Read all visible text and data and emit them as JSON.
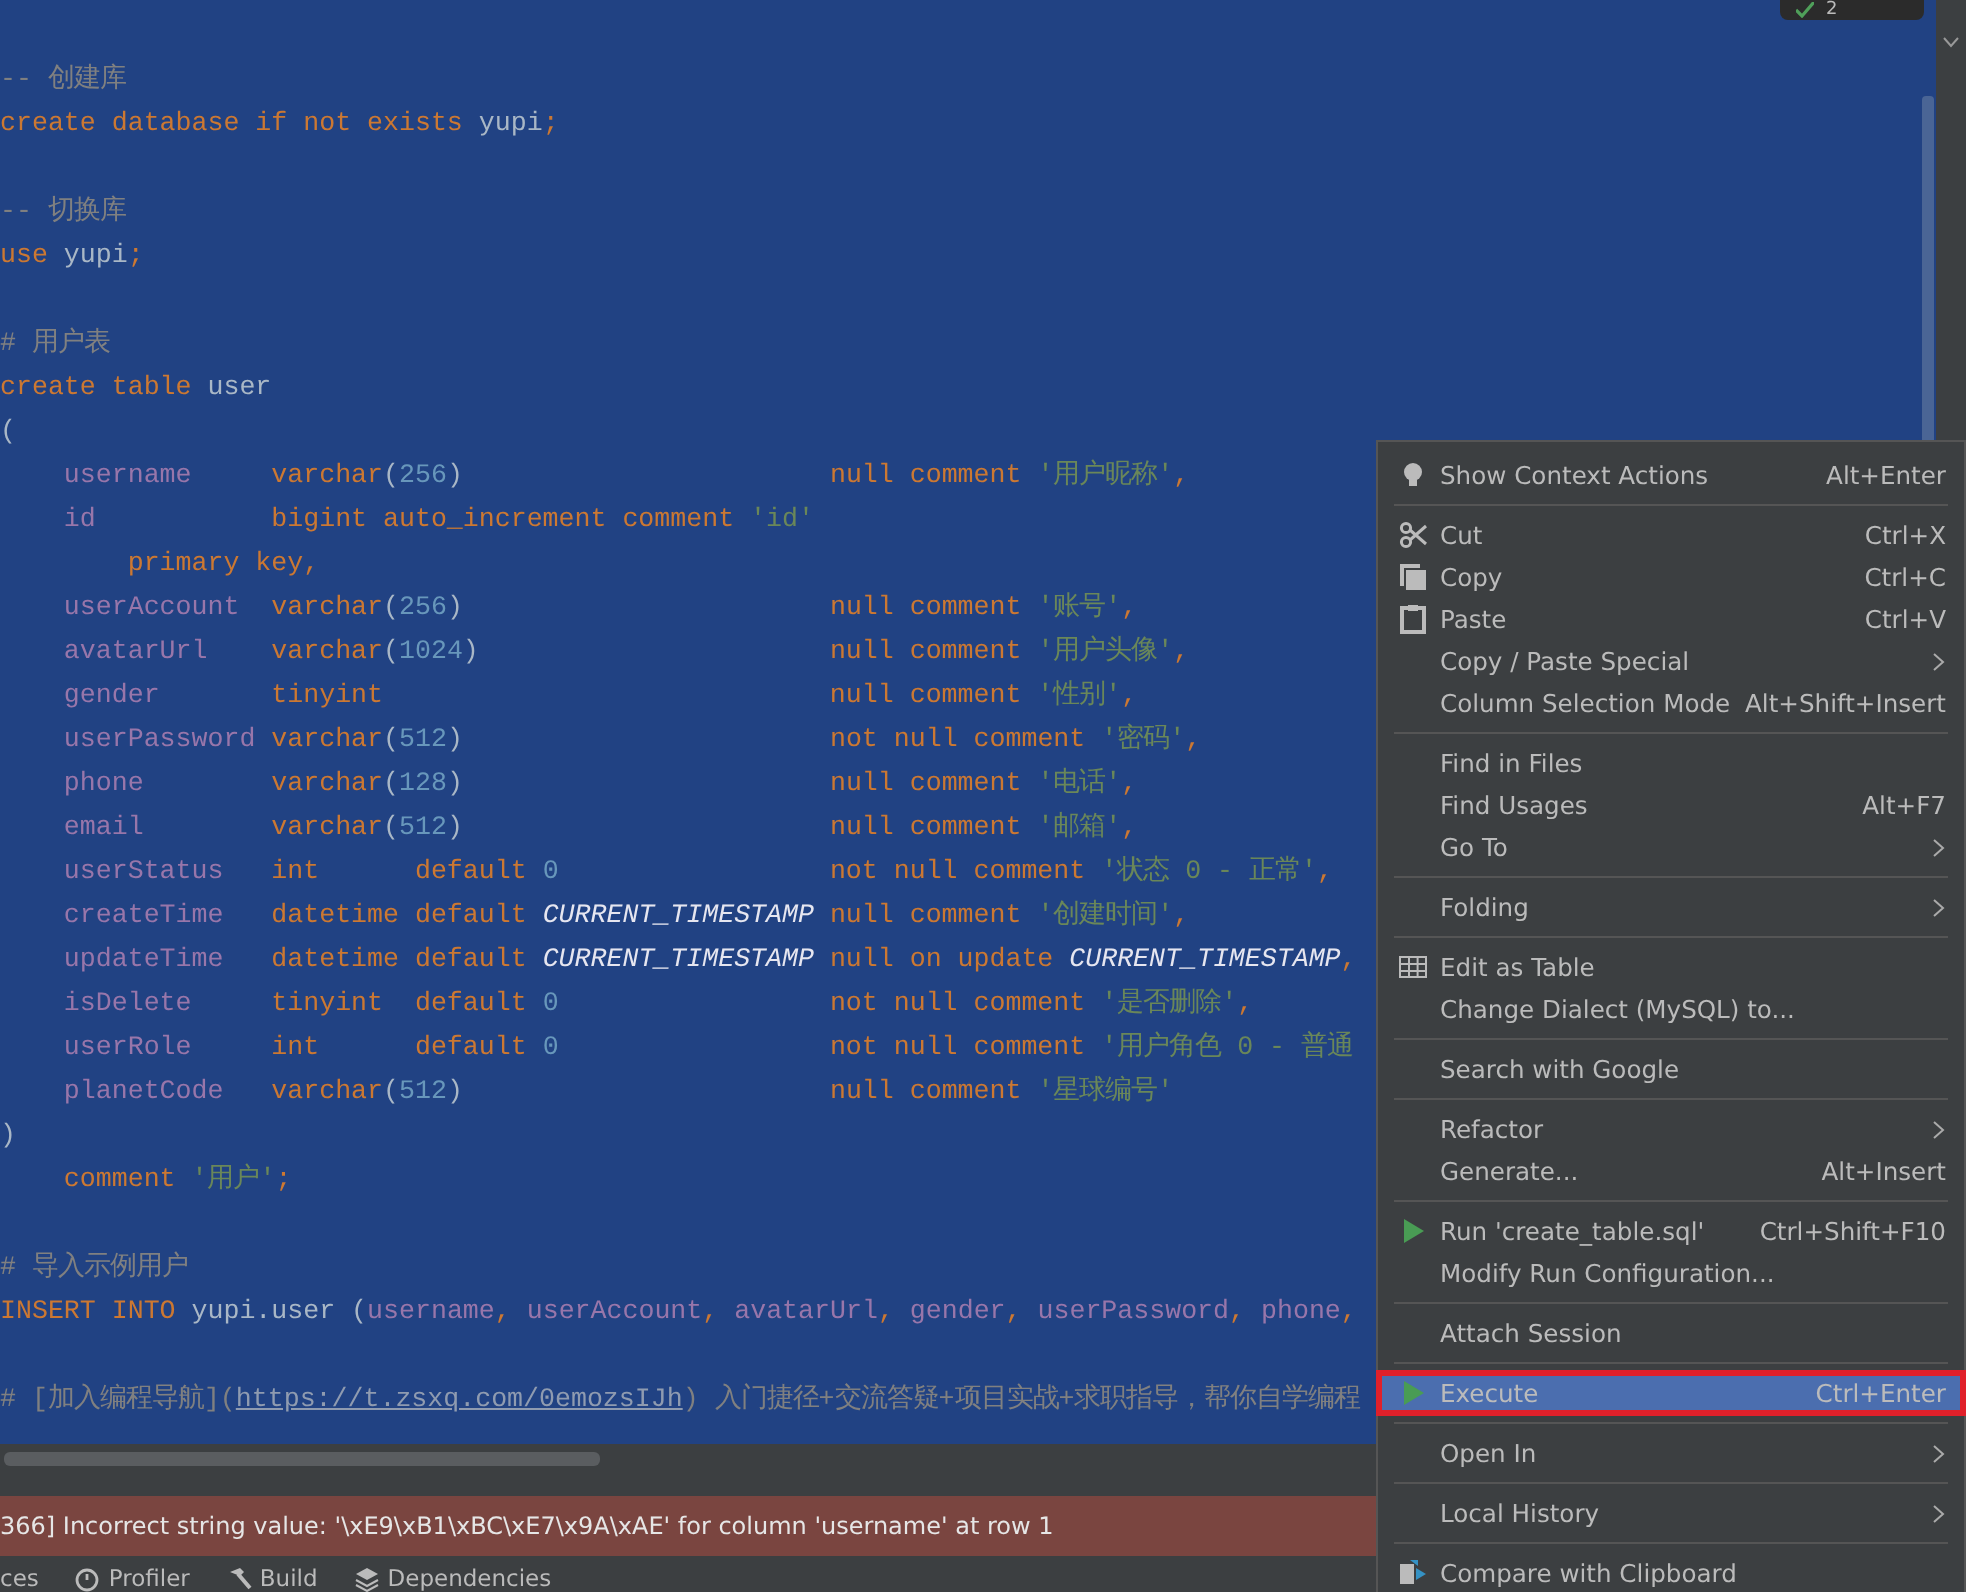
{
  "editor": {
    "inspection_count": "2",
    "blocks": [
      [
        [
          {
            "kind": "cmt",
            "text": "-- 创建库"
          }
        ],
        [
          {
            "kind": "kw",
            "text": "create database if not exists "
          },
          {
            "kind": "plain",
            "text": "yupi"
          },
          {
            "kind": "kw",
            "text": ";"
          }
        ]
      ],
      [
        [
          {
            "kind": "cmt",
            "text": "-- 切换库"
          }
        ],
        [
          {
            "kind": "kw",
            "text": "use "
          },
          {
            "kind": "plain",
            "text": "yupi"
          },
          {
            "kind": "kw",
            "text": ";"
          }
        ]
      ],
      [
        [
          {
            "kind": "cmt",
            "text": "# 用户表"
          }
        ],
        [
          {
            "kind": "kw",
            "text": "create table "
          },
          {
            "kind": "plain",
            "text": "user"
          }
        ],
        [
          {
            "kind": "plain",
            "text": "("
          }
        ],
        [
          {
            "kind": "col",
            "text": "    username     "
          },
          {
            "kind": "kw",
            "text": "varchar"
          },
          {
            "kind": "plain",
            "text": "("
          },
          {
            "kind": "num",
            "text": "256"
          },
          {
            "kind": "plain",
            "text": ")                       "
          },
          {
            "kind": "kw",
            "text": "null comment "
          },
          {
            "kind": "str",
            "text": "'用户昵称'"
          },
          {
            "kind": "kw",
            "text": ","
          }
        ],
        [
          {
            "kind": "col",
            "text": "    id           "
          },
          {
            "kind": "kw",
            "text": "bigint auto_increment comment "
          },
          {
            "kind": "str",
            "text": "'id'"
          }
        ],
        [
          {
            "kind": "kw",
            "text": "        primary key,"
          }
        ],
        [
          {
            "kind": "col",
            "text": "    userAccount  "
          },
          {
            "kind": "kw",
            "text": "varchar"
          },
          {
            "kind": "plain",
            "text": "("
          },
          {
            "kind": "num",
            "text": "256"
          },
          {
            "kind": "plain",
            "text": ")                       "
          },
          {
            "kind": "kw",
            "text": "null comment "
          },
          {
            "kind": "str",
            "text": "'账号'"
          },
          {
            "kind": "kw",
            "text": ","
          }
        ],
        [
          {
            "kind": "col",
            "text": "    avatarUrl    "
          },
          {
            "kind": "kw",
            "text": "varchar"
          },
          {
            "kind": "plain",
            "text": "("
          },
          {
            "kind": "num",
            "text": "1024"
          },
          {
            "kind": "plain",
            "text": ")                      "
          },
          {
            "kind": "kw",
            "text": "null comment "
          },
          {
            "kind": "str",
            "text": "'用户头像'"
          },
          {
            "kind": "kw",
            "text": ","
          }
        ],
        [
          {
            "kind": "col",
            "text": "    gender       "
          },
          {
            "kind": "kw",
            "text": "tinyint                            null comment "
          },
          {
            "kind": "str",
            "text": "'性别'"
          },
          {
            "kind": "kw",
            "text": ","
          }
        ],
        [
          {
            "kind": "col",
            "text": "    userPassword "
          },
          {
            "kind": "kw",
            "text": "varchar"
          },
          {
            "kind": "plain",
            "text": "("
          },
          {
            "kind": "num",
            "text": "512"
          },
          {
            "kind": "plain",
            "text": ")                       "
          },
          {
            "kind": "kw",
            "text": "not null comment "
          },
          {
            "kind": "str",
            "text": "'密码'"
          },
          {
            "kind": "kw",
            "text": ","
          }
        ],
        [
          {
            "kind": "col",
            "text": "    phone        "
          },
          {
            "kind": "kw",
            "text": "varchar"
          },
          {
            "kind": "plain",
            "text": "("
          },
          {
            "kind": "num",
            "text": "128"
          },
          {
            "kind": "plain",
            "text": ")                       "
          },
          {
            "kind": "kw",
            "text": "null comment "
          },
          {
            "kind": "str",
            "text": "'电话'"
          },
          {
            "kind": "kw",
            "text": ","
          }
        ],
        [
          {
            "kind": "col",
            "text": "    email        "
          },
          {
            "kind": "kw",
            "text": "varchar"
          },
          {
            "kind": "plain",
            "text": "("
          },
          {
            "kind": "num",
            "text": "512"
          },
          {
            "kind": "plain",
            "text": ")                       "
          },
          {
            "kind": "kw",
            "text": "null comment "
          },
          {
            "kind": "str",
            "text": "'邮箱'"
          },
          {
            "kind": "kw",
            "text": ","
          }
        ],
        [
          {
            "kind": "col",
            "text": "    userStatus   "
          },
          {
            "kind": "kw",
            "text": "int      default "
          },
          {
            "kind": "num",
            "text": "0                 "
          },
          {
            "kind": "kw",
            "text": "not null comment "
          },
          {
            "kind": "str",
            "text": "'状态 0 - 正常'"
          },
          {
            "kind": "kw",
            "text": ","
          }
        ],
        [
          {
            "kind": "col",
            "text": "    createTime   "
          },
          {
            "kind": "kw",
            "text": "datetime default "
          },
          {
            "kind": "fn",
            "text": "CURRENT_TIMESTAMP"
          },
          {
            "kind": "kw",
            "text": " null comment "
          },
          {
            "kind": "str",
            "text": "'创建时间'"
          },
          {
            "kind": "kw",
            "text": ","
          }
        ],
        [
          {
            "kind": "col",
            "text": "    updateTime   "
          },
          {
            "kind": "kw",
            "text": "datetime default "
          },
          {
            "kind": "fn",
            "text": "CURRENT_TIMESTAMP"
          },
          {
            "kind": "kw",
            "text": " null on update "
          },
          {
            "kind": "fn",
            "text": "CURRENT_TIMESTAMP"
          },
          {
            "kind": "kw",
            "text": ","
          }
        ],
        [
          {
            "kind": "col",
            "text": "    isDelete     "
          },
          {
            "kind": "kw",
            "text": "tinyint  default "
          },
          {
            "kind": "num",
            "text": "0                 "
          },
          {
            "kind": "kw",
            "text": "not null comment "
          },
          {
            "kind": "str",
            "text": "'是否删除'"
          },
          {
            "kind": "kw",
            "text": ","
          }
        ],
        [
          {
            "kind": "col",
            "text": "    userRole     "
          },
          {
            "kind": "kw",
            "text": "int      default "
          },
          {
            "kind": "num",
            "text": "0                 "
          },
          {
            "kind": "kw",
            "text": "not null comment "
          },
          {
            "kind": "str",
            "text": "'用户角色 0 - 普通"
          }
        ],
        [
          {
            "kind": "col",
            "text": "    planetCode   "
          },
          {
            "kind": "kw",
            "text": "varchar"
          },
          {
            "kind": "plain",
            "text": "("
          },
          {
            "kind": "num",
            "text": "512"
          },
          {
            "kind": "plain",
            "text": ")                       "
          },
          {
            "kind": "kw",
            "text": "null comment "
          },
          {
            "kind": "str",
            "text": "'星球编号'"
          }
        ],
        [
          {
            "kind": "plain",
            "text": ")"
          }
        ],
        [
          {
            "kind": "kw",
            "text": "    comment "
          },
          {
            "kind": "str",
            "text": "'用户'"
          },
          {
            "kind": "kw",
            "text": ";"
          }
        ]
      ],
      [
        [
          {
            "kind": "cmt",
            "text": "# 导入示例用户"
          }
        ],
        [
          {
            "kind": "kw",
            "text": "INSERT INTO "
          },
          {
            "kind": "plain",
            "text": "yupi.user ("
          },
          {
            "kind": "col",
            "text": "username"
          },
          {
            "kind": "kw",
            "text": ", "
          },
          {
            "kind": "col",
            "text": "userAccount"
          },
          {
            "kind": "kw",
            "text": ", "
          },
          {
            "kind": "col",
            "text": "avatarUrl"
          },
          {
            "kind": "kw",
            "text": ", "
          },
          {
            "kind": "col",
            "text": "gender"
          },
          {
            "kind": "kw",
            "text": ", "
          },
          {
            "kind": "col",
            "text": "userPassword"
          },
          {
            "kind": "kw",
            "text": ", "
          },
          {
            "kind": "col",
            "text": "phone"
          },
          {
            "kind": "kw",
            "text": ","
          }
        ]
      ],
      [
        [
          {
            "kind": "cmt",
            "text": "# [加入编程导航]("
          },
          {
            "kind": "link",
            "text": "https://t.zsxq.com/0emozsIJh"
          },
          {
            "kind": "cmt",
            "text": ") 入门捷径+交流答疑+项目实战+求职指导，帮你自学编程"
          }
        ]
      ]
    ]
  },
  "context_menu": {
    "groups": [
      [
        {
          "label": "Show Context Actions",
          "shortcut": "Alt+Enter",
          "kind": "bulb",
          "submenu": false,
          "selected": false
        }
      ],
      [
        {
          "label": "Cut",
          "shortcut": "Ctrl+X",
          "kind": "cut",
          "submenu": false,
          "selected": false
        },
        {
          "label": "Copy",
          "shortcut": "Ctrl+C",
          "kind": "copy",
          "submenu": false,
          "selected": false
        },
        {
          "label": "Paste",
          "shortcut": "Ctrl+V",
          "kind": "paste",
          "submenu": false,
          "selected": false
        },
        {
          "label": "Copy / Paste Special",
          "submenu": true,
          "selected": false
        },
        {
          "label": "Column Selection Mode",
          "shortcut": "Alt+Shift+Insert",
          "submenu": false,
          "selected": false
        }
      ],
      [
        {
          "label": "Find in Files",
          "submenu": false,
          "selected": false
        },
        {
          "label": "Find Usages",
          "shortcut": "Alt+F7",
          "submenu": false,
          "selected": false
        },
        {
          "label": "Go To",
          "submenu": true,
          "selected": false
        }
      ],
      [
        {
          "label": "Folding",
          "submenu": true,
          "selected": false
        }
      ],
      [
        {
          "label": "Edit as Table",
          "kind": "table",
          "submenu": false,
          "selected": false
        },
        {
          "label": "Change Dialect (MySQL) to...",
          "submenu": false,
          "selected": false
        }
      ],
      [
        {
          "label": "Search with Google",
          "submenu": false,
          "selected": false
        }
      ],
      [
        {
          "label": "Refactor",
          "submenu": true,
          "selected": false
        },
        {
          "label": "Generate...",
          "shortcut": "Alt+Insert",
          "submenu": false,
          "selected": false
        }
      ],
      [
        {
          "label": "Run 'create_table.sql'",
          "shortcut": "Ctrl+Shift+F10",
          "kind": "run",
          "submenu": false,
          "selected": false
        },
        {
          "label": "Modify Run Configuration...",
          "submenu": false,
          "selected": false
        }
      ],
      [
        {
          "label": "Attach Session",
          "submenu": false,
          "selected": false
        }
      ],
      [
        {
          "label": "Execute",
          "shortcut": "Ctrl+Enter",
          "kind": "run",
          "submenu": false,
          "selected": true
        }
      ],
      [
        {
          "label": "Open In",
          "submenu": true,
          "selected": false
        }
      ],
      [
        {
          "label": "Local History",
          "submenu": true,
          "selected": false
        }
      ],
      [
        {
          "label": "Compare with Clipboard",
          "kind": "compare",
          "submenu": false,
          "selected": false
        }
      ]
    ]
  },
  "error_bar": {
    "message": "366] Incorrect string value: '\\xE9\\xB1\\xBC\\xE7\\x9A\\xAE' for column 'username' at row 1"
  },
  "tool_tabs": [
    {
      "label": "ces"
    },
    {
      "label": "Profiler",
      "kind": "profiler"
    },
    {
      "label": "Build",
      "kind": "build"
    },
    {
      "label": "Dependencies",
      "kind": "deps"
    }
  ]
}
